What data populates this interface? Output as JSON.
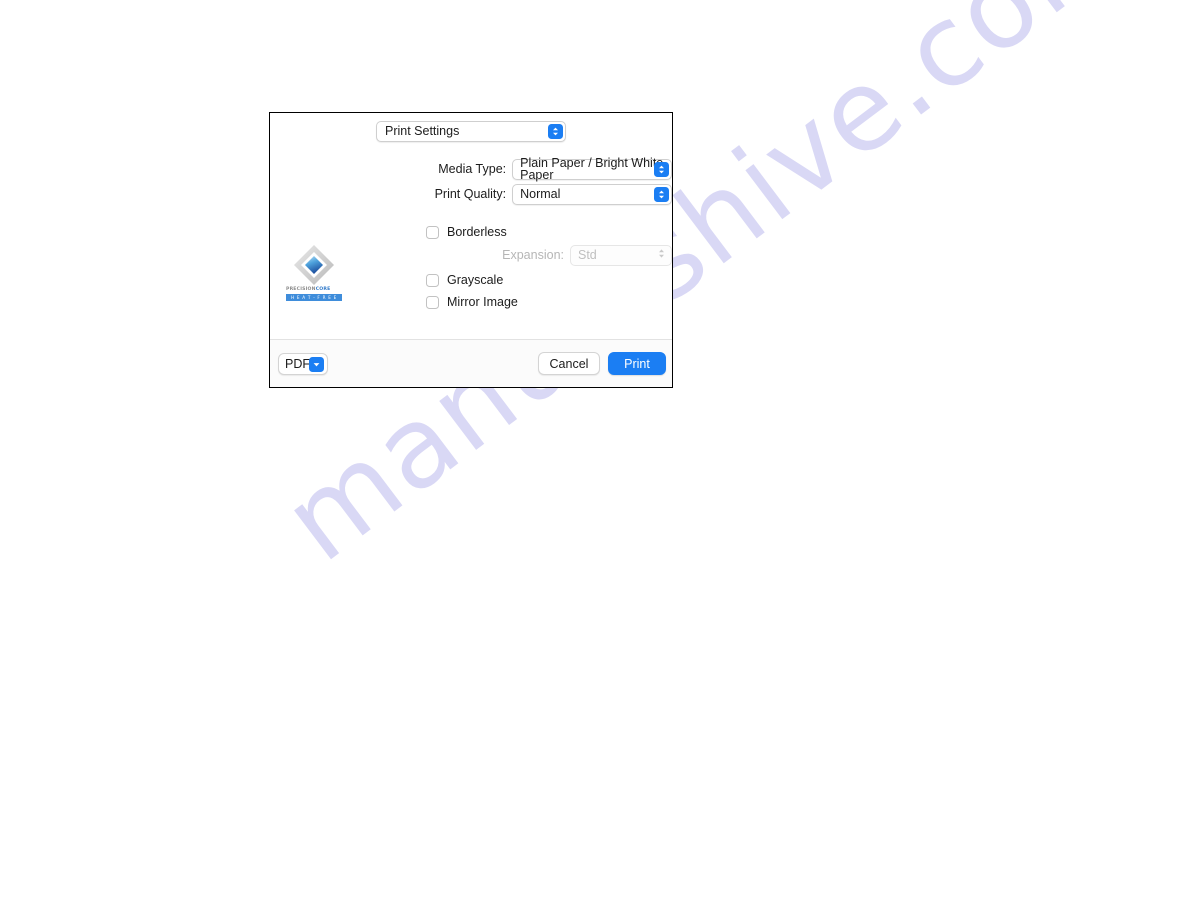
{
  "page": {
    "background_color": "#ffffff",
    "watermark_text": "manualshive.com",
    "watermark_color": "#d9d8f5"
  },
  "dialog": {
    "name": "print-dialog",
    "accent_color": "#1b7ef3",
    "pane_popup": {
      "label": "Print Settings",
      "icon": "up-down-chevron-icon"
    },
    "fields": [
      {
        "label": "Media Type:",
        "value": "Plain Paper / Bright White Paper",
        "icon": "up-down-chevron-icon",
        "disabled": false
      },
      {
        "label": "Print Quality:",
        "value": "Normal",
        "icon": "up-down-chevron-icon",
        "disabled": false
      }
    ],
    "expansion": {
      "label": "Expansion:",
      "value": "Std",
      "icon": "up-down-chevron-icon",
      "disabled": true
    },
    "checkboxes": [
      {
        "label": "Borderless",
        "checked": false
      },
      {
        "label": "Grayscale",
        "checked": false
      },
      {
        "label": "Mirror Image",
        "checked": false
      }
    ],
    "logo": {
      "name": "precisioncore-heat-free-logo",
      "wordmark_primary": "PRECISION",
      "wordmark_accent": "CORE",
      "wordmark_secondary": "H E A T - F R E E"
    },
    "buttons": {
      "pdf": {
        "label": "PDF",
        "icon": "chevron-down-icon"
      },
      "cancel": {
        "label": "Cancel"
      },
      "print": {
        "label": "Print"
      }
    }
  }
}
